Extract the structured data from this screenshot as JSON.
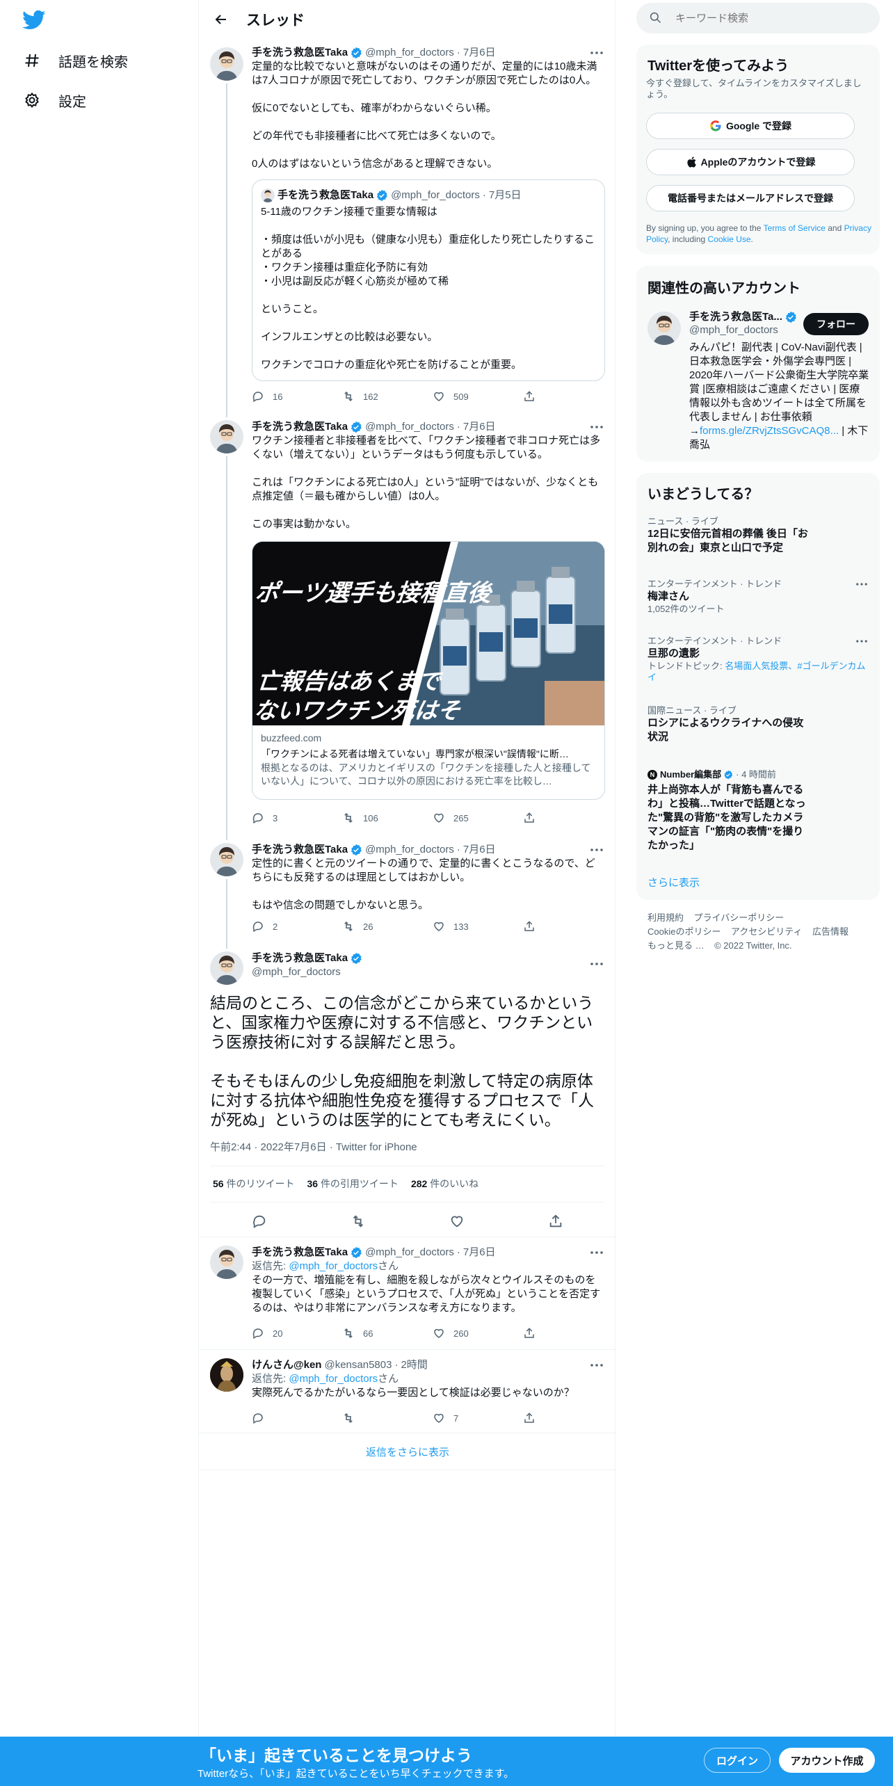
{
  "nav": {
    "explore": "話題を検索",
    "settings": "設定"
  },
  "header": {
    "title": "スレッド"
  },
  "tweets": [
    {
      "user": "手を洗う救急医Taka",
      "handle": "@mph_for_doctors",
      "time": "7月6日",
      "text": "定量的な比較でないと意味がないのはその通りだが、定量的には10歳未満は7人コロナが原因で死亡しており、ワクチンが原因で死亡したのは0人。\n\n仮に0でないとしても、確率がわからないぐらい稀。\n\nどの年代でも非接種者に比べて死亡は多くないので。\n\n0人のはずはないという信念があると理解できない。",
      "quote": {
        "user": "手を洗う救急医Taka",
        "handle": "@mph_for_doctors",
        "time": "7月5日",
        "text": "5-11歳のワクチン接種で重要な情報は\n\n・頻度は低いが小児も（健康な小児も）重症化したり死亡したりすることがある\n・ワクチン接種は重症化予防に有効\n・小児は副反応が軽く心筋炎が極めて稀\n\nということ。\n\nインフルエンザとの比較は必要ない。\n\nワクチンでコロナの重症化や死亡を防げることが重要。"
      },
      "replies": "16",
      "retweets": "162",
      "likes": "509"
    },
    {
      "user": "手を洗う救急医Taka",
      "handle": "@mph_for_doctors",
      "time": "7月6日",
      "text": "ワクチン接種者と非接種者を比べて、「ワクチン接種者で非コロナ死亡は多くない（増えてない）」というデータはもう何度も示している。\n\nこれは「ワクチンによる死亡は0人」という\"証明\"ではないが、少なくとも点推定値（＝最も確からしい値）は0人。\n\nこの事実は動かない。",
      "card": {
        "image_text_1": "ポーツ選手も接種直後",
        "image_text_2": "亡報告はあくまで\nないワクチン死はそ\nいでしょう",
        "domain": "buzzfeed.com",
        "title": "「ワクチンによる死者は増えていない」専門家が根深い\"誤情報\"に断…",
        "desc": "根拠となるのは、アメリカとイギリスの「ワクチンを接種した人と接種していない人」について、コロナ以外の原因における死亡率を比較し…"
      },
      "replies": "3",
      "retweets": "106",
      "likes": "265"
    },
    {
      "user": "手を洗う救急医Taka",
      "handle": "@mph_for_doctors",
      "time": "7月6日",
      "text": "定性的に書くと元のツイートの通りで、定量的に書くとこうなるので、どちらにも反発するのは理屈としてはおかしい。\n\nもはや信念の問題でしかないと思う。",
      "replies": "2",
      "retweets": "26",
      "likes": "133"
    }
  ],
  "main_tweet": {
    "user": "手を洗う救急医Taka",
    "handle": "@mph_for_doctors",
    "text": "結局のところ、この信念がどこから来ているかというと、国家権力や医療に対する不信感と、ワクチンという医療技術に対する誤解だと思う。\n\nそもそもほんの少し免疫細胞を刺激して特定の病原体に対する抗体や細胞性免疫を獲得するプロセスで「人が死ぬ」というのは医学的にとても考えにくい。",
    "timestamp": "午前2:44 · 2022年7月6日 · Twitter for iPhone",
    "retweets_num": "56",
    "retweets_label": "件のリツイート",
    "quotes_num": "36",
    "quotes_label": "件の引用ツイート",
    "likes_num": "282",
    "likes_label": "件のいいね"
  },
  "replies": [
    {
      "user": "手を洗う救急医Taka",
      "handle": "@mph_for_doctors",
      "time": "7月6日",
      "reply_prefix": "返信先: ",
      "reply_to": "@mph_for_doctors",
      "reply_suffix": "さん",
      "text": "その一方で、増殖能を有し、細胞を殺しながら次々とウイルスそのものを複製していく「感染」というプロセスで、「人が死ぬ」ということを否定するのは、やはり非常にアンバランスな考え方になります。",
      "replies": "20",
      "retweets": "66",
      "likes": "260"
    },
    {
      "user": "けんさん@ken",
      "handle": "@kensan5803",
      "time": "2時間",
      "reply_prefix": "返信先: ",
      "reply_to": "@mph_for_doctors",
      "reply_suffix": "さん",
      "text": "実際死んでるかたがいるなら一要因として検証は必要じゃないのか？",
      "replies": "",
      "retweets": "",
      "likes": "7"
    }
  ],
  "show_more_replies": "返信をさらに表示",
  "right": {
    "search_placeholder": "キーワード検索",
    "signup": {
      "title": "Twitterを使ってみよう",
      "subtitle": "今すぐ登録して、タイムラインをカスタマイズしましょう。",
      "google": "Google で登録",
      "apple": "Appleのアカウントで登録",
      "phone": "電話番号またはメールアドレスで登録",
      "legal_1": "By signing up, you agree to the ",
      "tos": "Terms of Service",
      "legal_2": " and ",
      "privacy": "Privacy Policy",
      "legal_3": ", including ",
      "cookie": "Cookie Use",
      "legal_4": "."
    },
    "relevant": {
      "title": "関連性の高いアカウント",
      "name": "手を洗う救急医Ta...",
      "handle": "@mph_for_doctors",
      "follow": "フォロー",
      "bio": "みんパピ！副代表 | CoV-Navi副代表 | 日本救急医学会・外傷学会専門医 | 2020年ハーバード公衆衛生大学院卒業賞 |医療相談はご遠慮ください | 医療情報以外も含めツイートは全て所属を代表しません | お仕事依頼 →",
      "bio_link": "forms.gle/ZRvjZtsSGvCAQ8...",
      "bio_end": " | 木下喬弘"
    },
    "trends": {
      "title": "いまどうしてる？",
      "t1_cat": "ニュース · ライブ",
      "t1_name": "12日に安倍元首相の葬儀 後日「お\n別れの会」東京と山口で予定",
      "t2_cat": "エンターテインメント · トレンド",
      "t2_name": "梅津さん",
      "t2_sub": "1,052件のツイート",
      "t3_cat": "エンターテインメント · トレンド",
      "t3_name": "旦那の遺影",
      "t3_sub_label": "トレンドトピック: ",
      "t3_sub_links": "名場面人気投票、#ゴールデンカム\nイ",
      "t4_cat": "国際ニュース · ライブ",
      "t4_name": "ロシアによるウクライナへの侵攻\n状況",
      "t5_source": "Number編集部",
      "t5_time": "· 4 時間前",
      "t5_name": "井上尚弥本人が「背筋も喜んでる\nわ」と投稿…Twitterで話題となっ\nた\"驚異の背筋\"を激写したカメラ\nマンの証言「\"筋肉の表情\"を撮り\nたかった」",
      "show_more": "さらに表示"
    },
    "footer": {
      "terms": "利用規約",
      "privacy": "プライバシーポリシー",
      "cookie": "Cookieのポリシー",
      "access": "アクセシビリティ",
      "ads": "広告情報",
      "more": "もっと見る …",
      "copyright": "© 2022 Twitter, Inc."
    }
  },
  "bottom": {
    "title": "「いま」起きていることを見つけよう",
    "subtitle": "Twitterなら、「いま」起きていることをいち早くチェックできます。",
    "login": "ログイン",
    "signup": "アカウント作成"
  },
  "colors": {
    "accent": "#1d9bf0",
    "text": "#0f1419",
    "muted": "#536471"
  }
}
